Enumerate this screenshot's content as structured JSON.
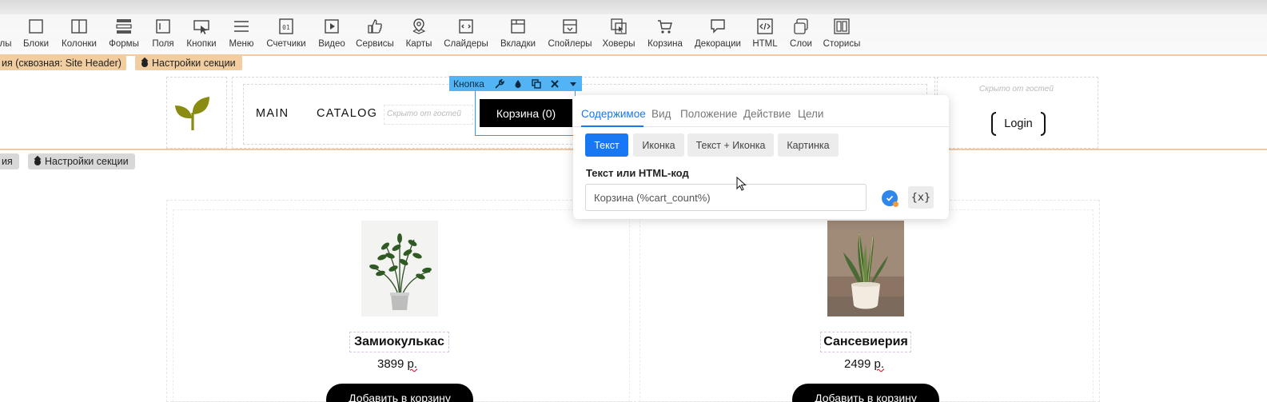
{
  "toolbar": {
    "items": [
      {
        "label": "лы",
        "icon": "cover-icon"
      },
      {
        "label": "Блоки",
        "icon": "blocks-icon"
      },
      {
        "label": "Колонки",
        "icon": "columns-icon"
      },
      {
        "label": "Формы",
        "icon": "forms-icon"
      },
      {
        "label": "Поля",
        "icon": "fields-icon"
      },
      {
        "label": "Кнопки",
        "icon": "buttons-icon"
      },
      {
        "label": "Меню",
        "icon": "menu-icon"
      },
      {
        "label": "Счетчики",
        "icon": "counters-icon"
      },
      {
        "label": "Видео",
        "icon": "video-icon"
      },
      {
        "label": "Сервисы",
        "icon": "services-icon"
      },
      {
        "label": "Карты",
        "icon": "maps-icon"
      },
      {
        "label": "Слайдеры",
        "icon": "sliders-icon"
      },
      {
        "label": "Вкладки",
        "icon": "tabs-icon"
      },
      {
        "label": "Спойлеры",
        "icon": "spoilers-icon"
      },
      {
        "label": "Ховеры",
        "icon": "hovers-icon"
      },
      {
        "label": "Корзина",
        "icon": "cart-icon"
      },
      {
        "label": "Декорации",
        "icon": "decorations-icon"
      },
      {
        "label": "HTML",
        "icon": "html-icon"
      },
      {
        "label": "Слои",
        "icon": "layers-icon"
      },
      {
        "label": "Сторисы",
        "icon": "stories-icon"
      }
    ]
  },
  "section_labels": {
    "header_section": "ия (сквозная: Site Header)",
    "header_settings": "Настройки секции",
    "catalog_section": "ия",
    "catalog_settings": "Настройки секции"
  },
  "header": {
    "nav": [
      "MAIN",
      "CATALOG"
    ],
    "hidden_note": "Скрыто от гостей",
    "cart_button": "Корзина (0)",
    "login": "Login"
  },
  "selection": {
    "label": "Кнопка",
    "tools": [
      "wrench-icon",
      "drop-icon",
      "copy-icon",
      "close-icon",
      "chevron-down-icon"
    ]
  },
  "popup": {
    "tabs": [
      "Содержимое",
      "Вид",
      "Положение",
      "Действие",
      "Цели"
    ],
    "active_tab": "Содержимое",
    "modes": [
      "Текст",
      "Иконка",
      "Текст + Иконка",
      "Картинка"
    ],
    "active_mode": "Текст",
    "field_label": "Текст или HTML-код",
    "field_value": "Корзина (%cart_count%)",
    "var_button": "{x}"
  },
  "products": [
    {
      "name": "Замиокулькас",
      "price_num": "3899",
      "price_unit": "р.",
      "button": "Добавить в корзину"
    },
    {
      "name": "Сансевиерия",
      "price_num": "2499",
      "price_unit": "р.",
      "button": "Добавить в корзину"
    }
  ],
  "colors": {
    "accent_blue": "#1877f2",
    "selection_blue": "#52b4f5",
    "section_tan": "#f1cd9f",
    "logo_olive": "#8a8c12"
  }
}
